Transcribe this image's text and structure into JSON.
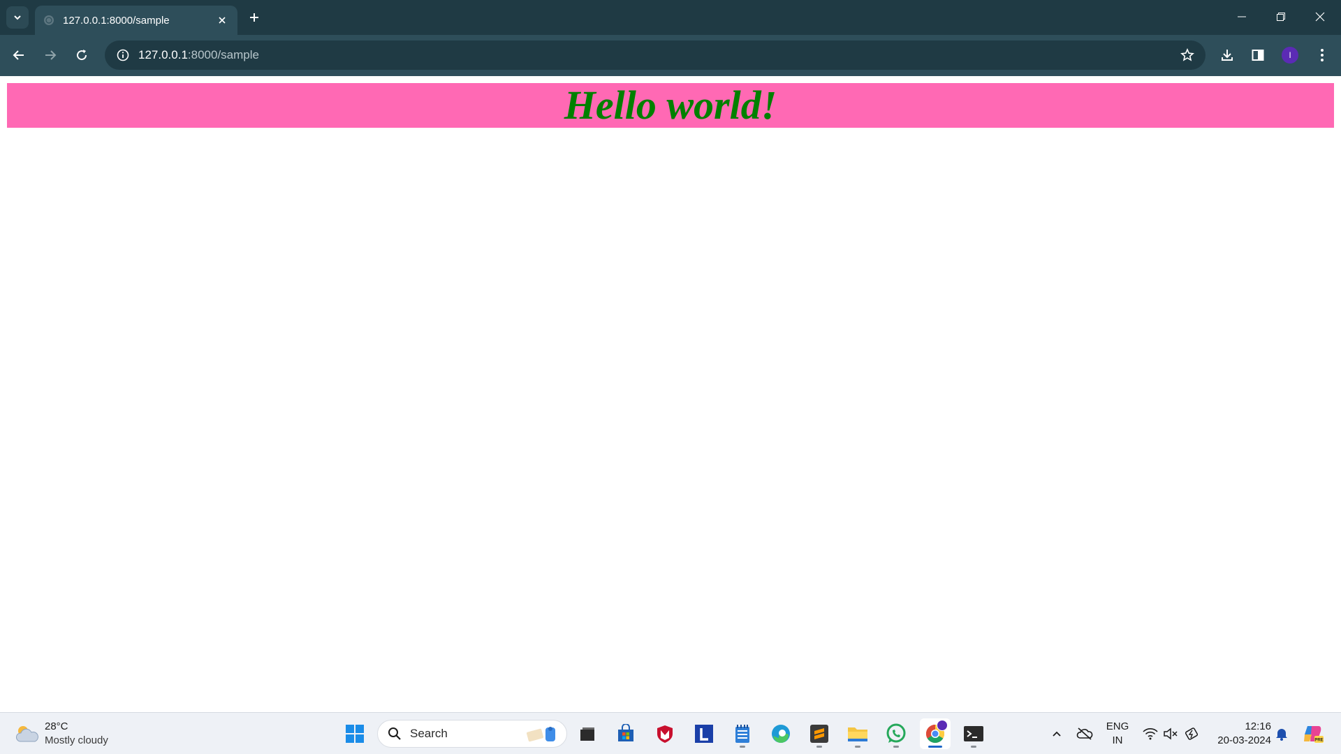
{
  "browser": {
    "tab": {
      "title": "127.0.0.1:8000/sample"
    },
    "address": {
      "host": "127.0.0.1",
      "path": ":8000/sample"
    },
    "profile_initial": "I"
  },
  "page": {
    "heading": "Hello world!",
    "banner_color": "#ff69b4",
    "heading_color": "#008000"
  },
  "taskbar": {
    "weather": {
      "temp": "28°C",
      "condition": "Mostly cloudy"
    },
    "search_label": "Search",
    "apps": [
      "file-explorer-dark",
      "microsoft-store",
      "mcafee",
      "l-app",
      "notepad",
      "edge",
      "sublime-text",
      "file-explorer",
      "whatsapp",
      "chrome",
      "terminal"
    ],
    "language": {
      "line1": "ENG",
      "line2": "IN"
    },
    "clock": {
      "time": "12:16",
      "date": "20-03-2024"
    }
  }
}
